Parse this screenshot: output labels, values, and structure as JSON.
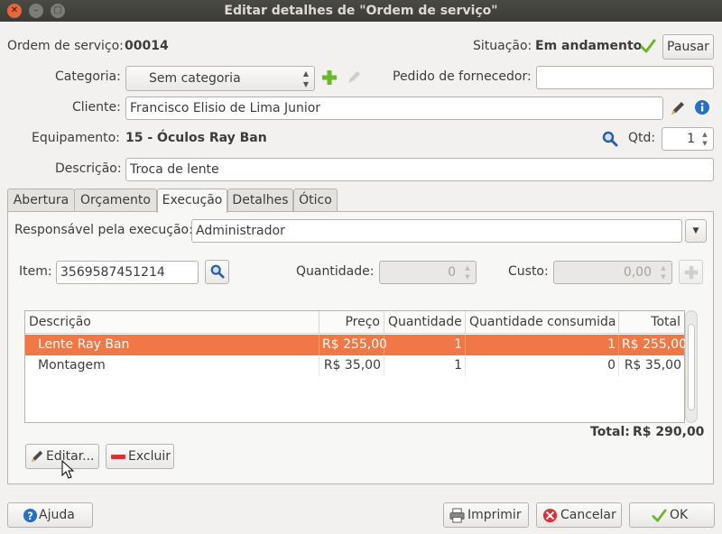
{
  "window": {
    "title": "Editar detalhes de \"Ordem de serviço\""
  },
  "header": {
    "os_label": "Ordem de serviço:",
    "os_number": "00014",
    "status_label": "Situação:",
    "status_value": "Em andamento",
    "pause_label": "Pausar"
  },
  "form": {
    "category_label": "Categoria:",
    "category_value": "Sem categoria",
    "supplier_order_label": "Pedido de fornecedor:",
    "supplier_order_value": "",
    "client_label": "Cliente:",
    "client_value": "Francisco Elisio de Lima Junior",
    "equipment_label": "Equipamento:",
    "equipment_value": "15 - Óculos Ray Ban",
    "qty_label": "Qtd:",
    "qty_value": "1",
    "description_label": "Descrição:",
    "description_value": "Troca de lente"
  },
  "tabs": [
    "Abertura",
    "Orçamento",
    "Execução",
    "Detalhes",
    "Ótico"
  ],
  "active_tab": "Execução",
  "execution": {
    "responsible_label": "Responsável pela execução:",
    "responsible_value": "Administrador",
    "item_label": "Item:",
    "item_value": "3569587451214",
    "quantity_label": "Quantidade:",
    "quantity_value": "0",
    "cost_label": "Custo:",
    "cost_value": "0,00",
    "columns": [
      "Descrição",
      "Preço",
      "Quantidade",
      "Quantidade consumida",
      "Total"
    ],
    "rows": [
      {
        "description": "Lente Ray Ban",
        "price": "R$ 255,00",
        "quantity": "1",
        "consumed": "1",
        "total": "R$ 255,00",
        "selected": true
      },
      {
        "description": "Montagem",
        "price": "R$ 35,00",
        "quantity": "1",
        "consumed": "0",
        "total": "R$ 35,00",
        "selected": false
      }
    ],
    "total_label": "Total:",
    "total_value": "R$ 290,00",
    "edit_label": "Editar...",
    "delete_label": "Excluir"
  },
  "footer": {
    "help_label": "Ajuda",
    "print_label": "Imprimir",
    "cancel_label": "Cancelar",
    "ok_label": "OK"
  },
  "colors": {
    "selection": "#f07746",
    "accent_green": "#6ab82a",
    "info_blue": "#2a6ec2",
    "titlebar": "#3b3b37"
  }
}
